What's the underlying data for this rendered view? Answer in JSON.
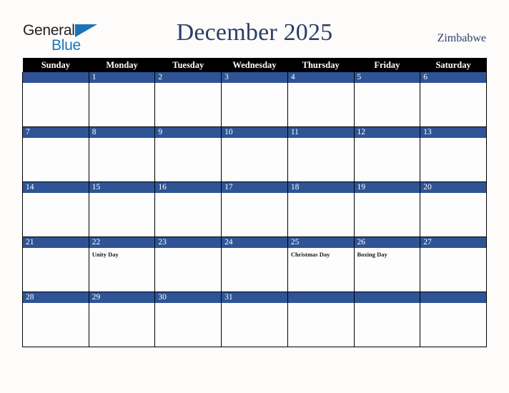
{
  "brand": {
    "name_part1": "General",
    "name_part2": "Blue",
    "triangle_icon": "blue-triangle-icon",
    "color_dark": "#231f20",
    "color_blue": "#1b74bb"
  },
  "header": {
    "title": "December 2025",
    "country": "Zimbabwe",
    "title_color": "#2c3e66"
  },
  "calendar": {
    "weekday_headers": [
      "Sunday",
      "Monday",
      "Tuesday",
      "Wednesday",
      "Thursday",
      "Friday",
      "Saturday"
    ],
    "header_bg": "#000000",
    "daynum_bg": "#2e5496",
    "cell_bg": "#fdfdfd",
    "weeks": [
      [
        {
          "num": "",
          "events": []
        },
        {
          "num": "1",
          "events": []
        },
        {
          "num": "2",
          "events": []
        },
        {
          "num": "3",
          "events": []
        },
        {
          "num": "4",
          "events": []
        },
        {
          "num": "5",
          "events": []
        },
        {
          "num": "6",
          "events": []
        }
      ],
      [
        {
          "num": "7",
          "events": []
        },
        {
          "num": "8",
          "events": []
        },
        {
          "num": "9",
          "events": []
        },
        {
          "num": "10",
          "events": []
        },
        {
          "num": "11",
          "events": []
        },
        {
          "num": "12",
          "events": []
        },
        {
          "num": "13",
          "events": []
        }
      ],
      [
        {
          "num": "14",
          "events": []
        },
        {
          "num": "15",
          "events": []
        },
        {
          "num": "16",
          "events": []
        },
        {
          "num": "17",
          "events": []
        },
        {
          "num": "18",
          "events": []
        },
        {
          "num": "19",
          "events": []
        },
        {
          "num": "20",
          "events": []
        }
      ],
      [
        {
          "num": "21",
          "events": []
        },
        {
          "num": "22",
          "events": [
            "Unity Day"
          ]
        },
        {
          "num": "23",
          "events": []
        },
        {
          "num": "24",
          "events": []
        },
        {
          "num": "25",
          "events": [
            "Christmas Day"
          ]
        },
        {
          "num": "26",
          "events": [
            "Boxing Day"
          ]
        },
        {
          "num": "27",
          "events": []
        }
      ],
      [
        {
          "num": "28",
          "events": []
        },
        {
          "num": "29",
          "events": []
        },
        {
          "num": "30",
          "events": []
        },
        {
          "num": "31",
          "events": []
        },
        {
          "num": "",
          "events": []
        },
        {
          "num": "",
          "events": []
        },
        {
          "num": "",
          "events": []
        }
      ]
    ]
  }
}
